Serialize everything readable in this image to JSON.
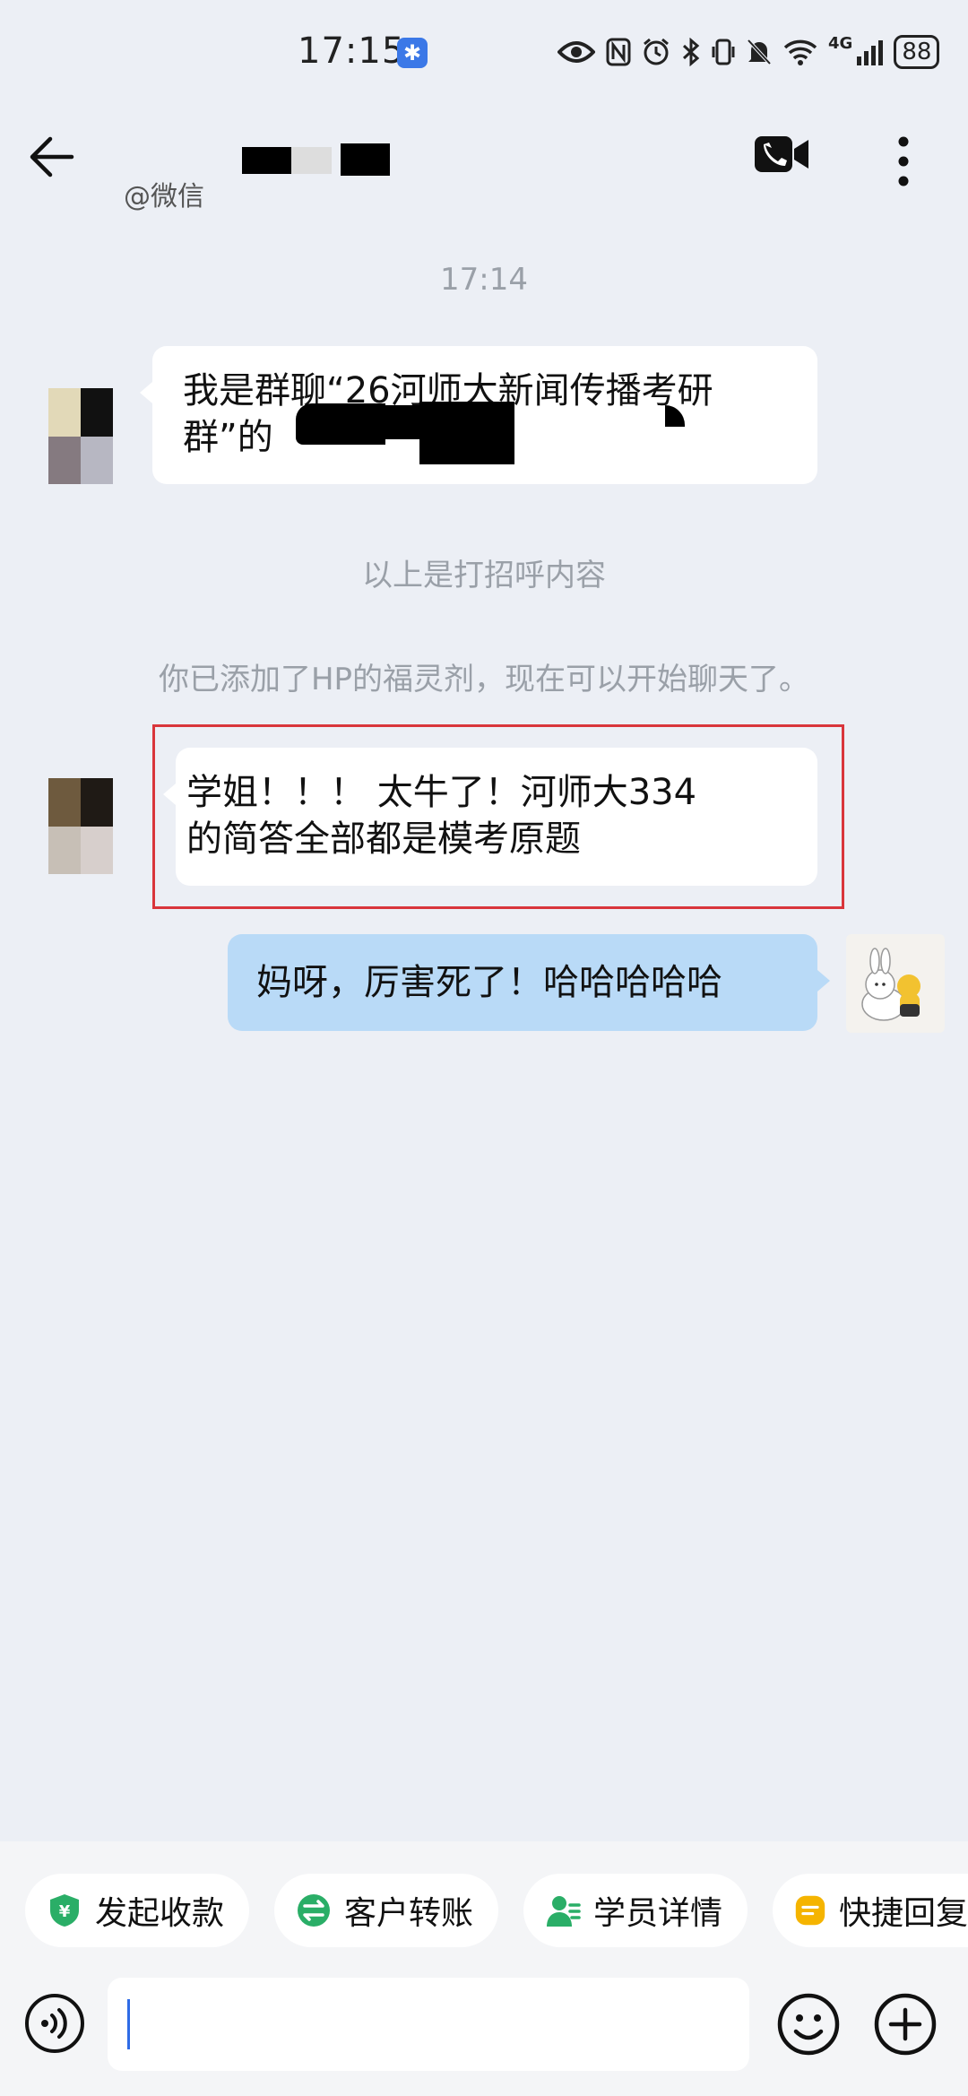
{
  "status_bar": {
    "time": "17:15",
    "badge_icon": "app-notification-icon",
    "icons": [
      "eye-icon",
      "nfc-icon",
      "alarm-icon",
      "bluetooth-icon",
      "vibrate-icon",
      "mute-icon",
      "wifi-icon",
      "signal-icon"
    ],
    "network": "4G",
    "battery": "88"
  },
  "header": {
    "source": "@微信",
    "back_icon": "back-arrow-icon",
    "video_icon": "video-call-icon",
    "more_icon": "more-vertical-icon"
  },
  "chat": {
    "timestamp": "17:14",
    "greeting_message": {
      "line1": "我是群聊“26河师大新闻传播考研",
      "line2": "群”的"
    },
    "note_greeting": "以上是打招呼内容",
    "note_added": "你已添加了HP的福灵剂，现在可以开始聊天了。",
    "incoming_message": {
      "line1": "学姐！！！ 太牛了！河师大334",
      "line2": "的简答全部都是模考原题"
    },
    "outgoing_message": "妈呀，厉害死了！哈哈哈哈哈"
  },
  "quick_actions": [
    {
      "label": "发起收款",
      "icon": "payment-shield-icon",
      "color": "#2aae67"
    },
    {
      "label": "客户转账",
      "icon": "transfer-icon",
      "color": "#2aae67"
    },
    {
      "label": "学员详情",
      "icon": "student-profile-icon",
      "color": "#2aae67"
    },
    {
      "label": "快捷回复",
      "icon": "quick-reply-icon",
      "color": "#f5b400"
    }
  ],
  "input": {
    "value": "",
    "voice_icon": "voice-input-icon",
    "emoji_icon": "emoji-icon",
    "plus_icon": "plus-icon"
  },
  "colors": {
    "background": "#eceff5",
    "outgoing_bubble": "#b9daf7",
    "incoming_bubble": "#ffffff",
    "highlight": "#d9353b"
  }
}
